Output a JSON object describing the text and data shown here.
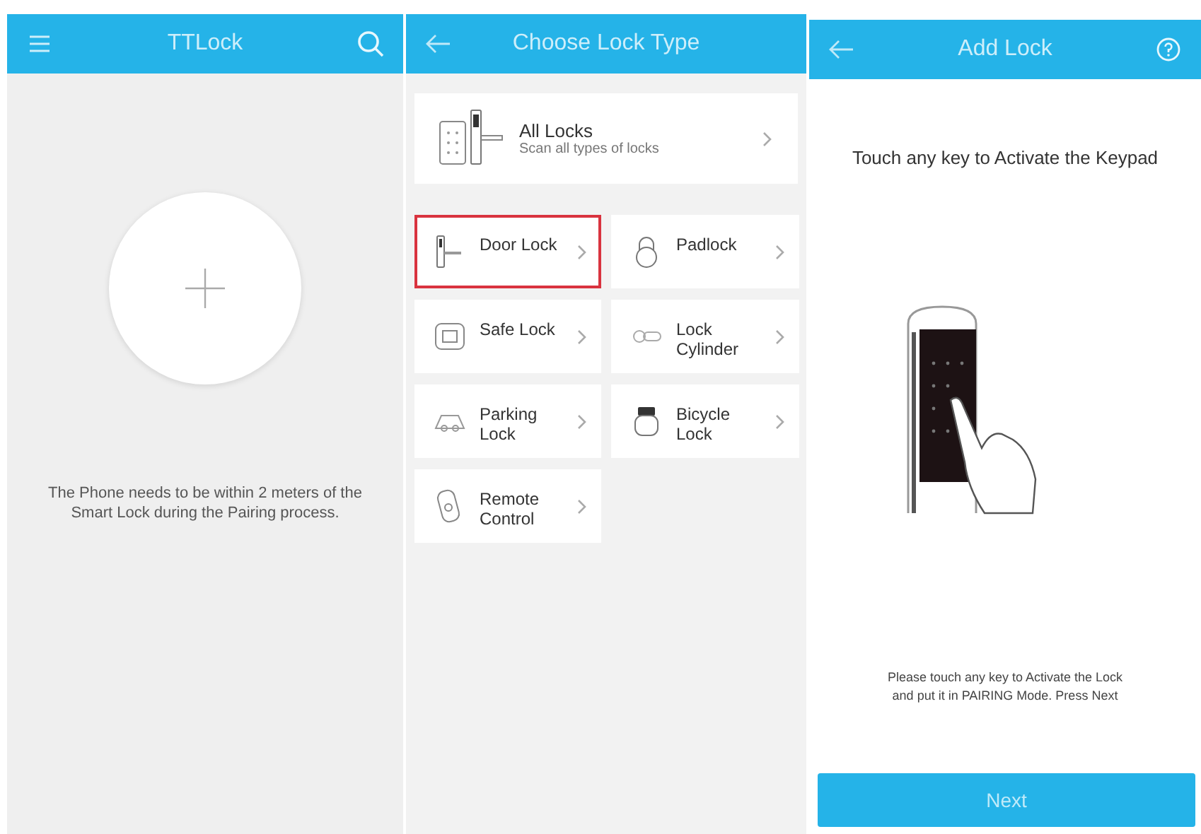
{
  "screens": [
    {
      "header": {
        "title": "TTLock"
      },
      "kind": "home",
      "message": "The Phone needs to be within 2 meters of the Smart Lock during the Pairing process."
    },
    {
      "header": {
        "title": "Choose Lock Type"
      },
      "kind": "types",
      "featured": {
        "label": "All Locks",
        "subtitle": "Scan all types of locks"
      },
      "tiles": [
        {
          "label": "Door Lock",
          "selected": true
        },
        {
          "label": "Padlock",
          "selected": false
        },
        {
          "label": "Safe Lock",
          "selected": false
        },
        {
          "label": "Lock Cylinder",
          "selected": false
        },
        {
          "label": "Parking Lock",
          "selected": false
        },
        {
          "label": "Bicycle Lock",
          "selected": false
        },
        {
          "label": "Remote Control",
          "selected": false
        }
      ]
    },
    {
      "header": {
        "title": "Add Lock"
      },
      "kind": "add",
      "heading": "Touch any key to Activate the Keypad",
      "instruction": "Please touch any key to Activate the Lock and put it in PAIRING Mode. Press Next",
      "button": "Next"
    }
  ]
}
